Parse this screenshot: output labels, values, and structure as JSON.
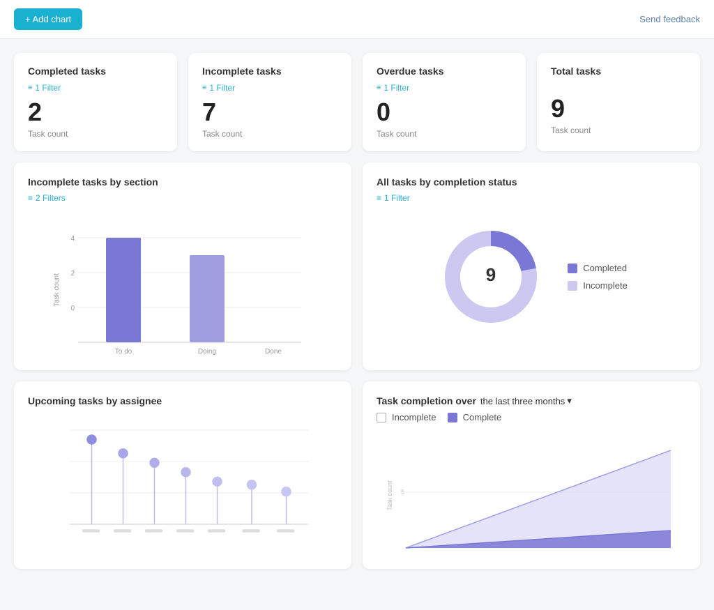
{
  "topbar": {
    "add_chart_label": "+ Add chart",
    "send_feedback_label": "Send feedback"
  },
  "stats": [
    {
      "title": "Completed tasks",
      "filter_label": "1 Filter",
      "number": "2",
      "sub": "Task count"
    },
    {
      "title": "Incomplete tasks",
      "filter_label": "1 Filter",
      "number": "7",
      "sub": "Task count"
    },
    {
      "title": "Overdue tasks",
      "filter_label": "1 Filter",
      "number": "0",
      "sub": "Task count"
    },
    {
      "title": "Total tasks",
      "filter_label": null,
      "number": "9",
      "sub": "Task count"
    }
  ],
  "bar_chart": {
    "title": "Incomplete tasks by section",
    "filter_label": "2 Filters",
    "y_label": "Task count",
    "bars": [
      {
        "label": "To do",
        "value": 4
      },
      {
        "label": "Doing",
        "value": 3
      },
      {
        "label": "Done",
        "value": 0
      }
    ],
    "max": 4,
    "y_ticks": [
      0,
      2,
      4
    ]
  },
  "donut_chart": {
    "title": "All tasks by completion status",
    "filter_label": "1 Filter",
    "center_value": "9",
    "completed_pct": 22,
    "incomplete_pct": 78,
    "legend": [
      {
        "label": "Completed",
        "color": "#7b78d5"
      },
      {
        "label": "Incomplete",
        "color": "#ccc8f0"
      }
    ]
  },
  "lollipop_chart": {
    "title": "Upcoming tasks by assignee",
    "sticks": [
      0.9,
      0.75,
      0.65,
      0.55,
      0.45,
      0.42,
      0.35
    ]
  },
  "line_chart": {
    "title": "Task completion over",
    "time_period": "the last three months",
    "legend": [
      {
        "label": "Incomplete"
      },
      {
        "label": "Complete"
      }
    ],
    "y_label": "Task count",
    "y_tick": "5"
  }
}
